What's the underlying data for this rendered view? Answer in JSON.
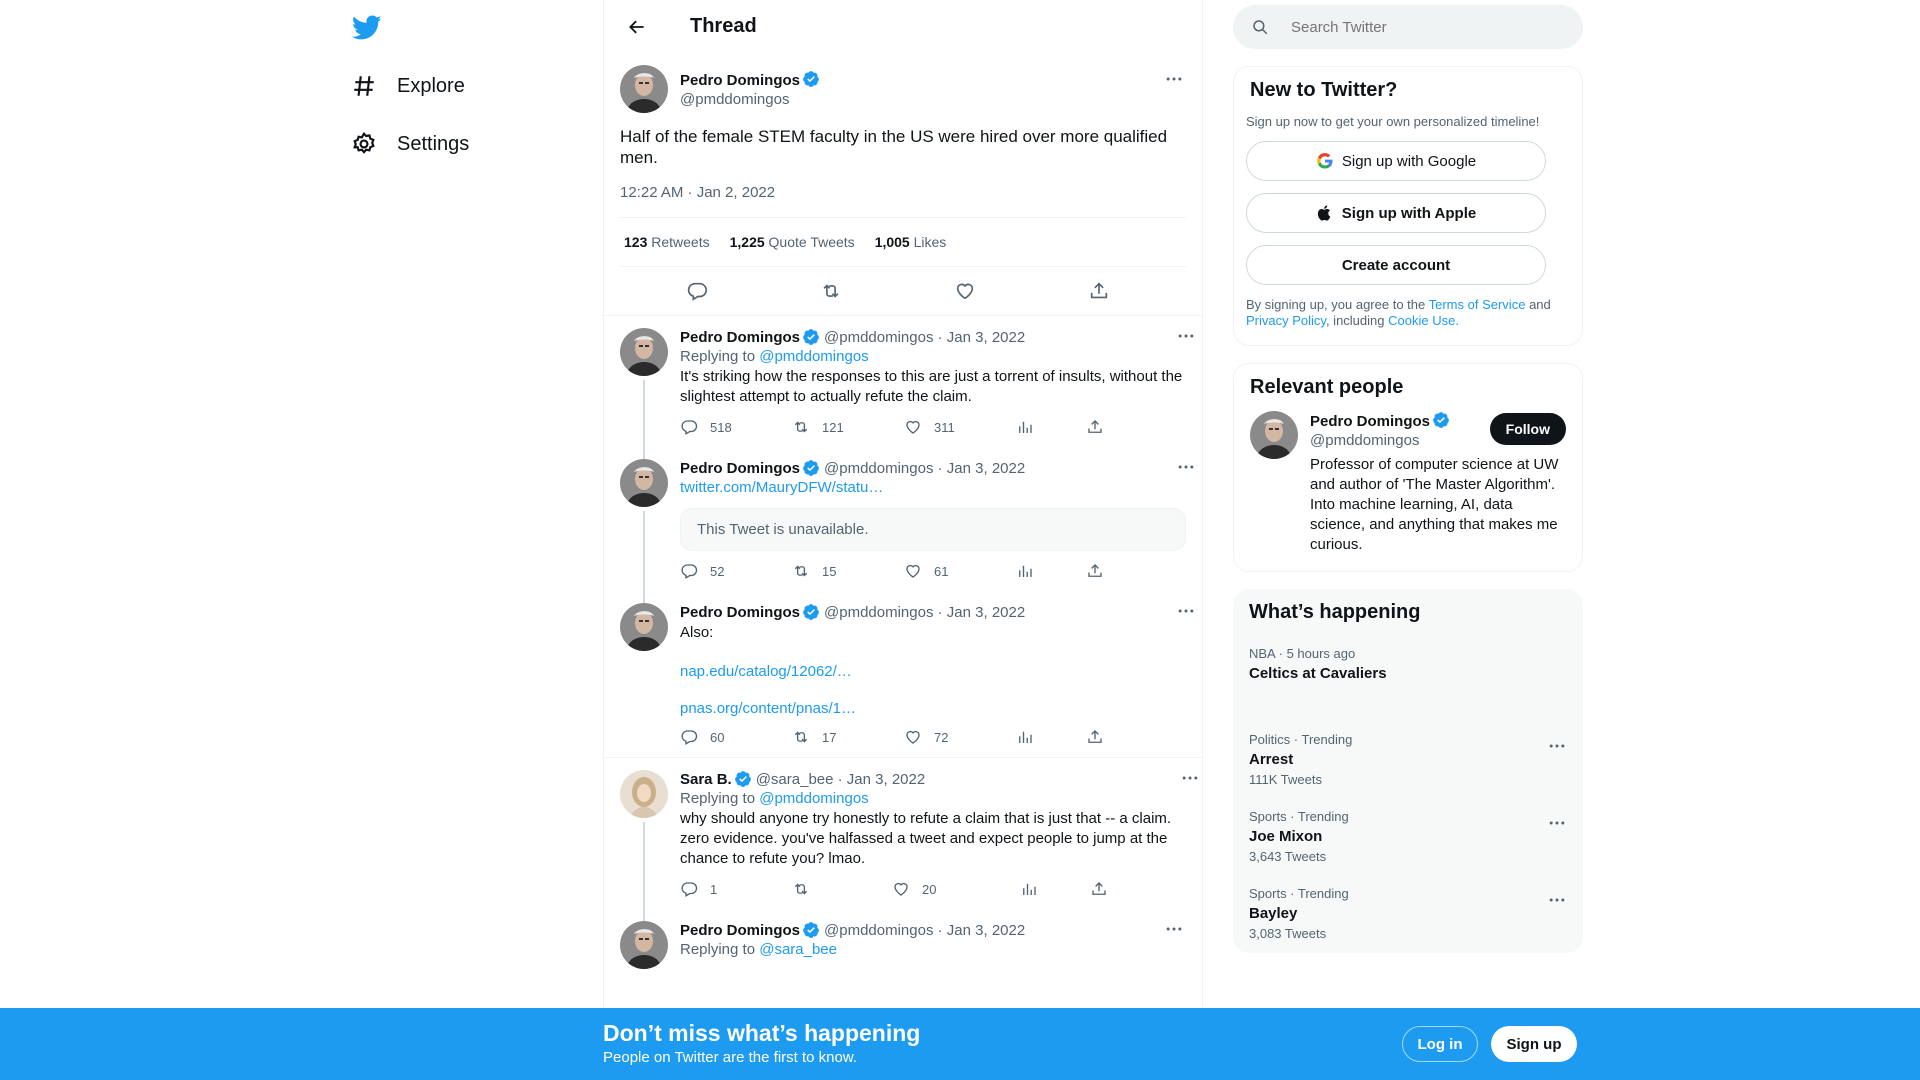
{
  "nav": {
    "explore": "Explore",
    "settings": "Settings"
  },
  "header": {
    "title": "Thread"
  },
  "main_tweet": {
    "name": "Pedro Domingos",
    "handle": "@pmddomingos",
    "text": "Half of the female STEM faculty in the US were hired over more qualified men.",
    "time": "12:22 AM · Jan 2, 2022",
    "retweets": "123",
    "retweets_label": "Retweets",
    "quotes": "1,225",
    "quotes_label": "Quote Tweets",
    "likes": "1,005",
    "likes_label": "Likes"
  },
  "replies": [
    {
      "name": "Pedro Domingos",
      "meta": "@pmddomingos · Jan 3, 2022",
      "replying_label": "Replying to",
      "replying_to": "@pmddomingos",
      "text": "It's striking how the responses to this are just a torrent of insults, without the slightest attempt to actually refute the claim.",
      "replies": "518",
      "retweets": "121",
      "likes": "311"
    },
    {
      "name": "Pedro Domingos",
      "meta": "@pmddomingos · Jan 3, 2022",
      "link": "twitter.com/MauryDFW/statu…",
      "unavailable": "This Tweet is unavailable.",
      "replies": "52",
      "retweets": "15",
      "likes": "61"
    },
    {
      "name": "Pedro Domingos",
      "meta": "@pmddomingos · Jan 3, 2022",
      "text": "Also:",
      "link1": "nap.edu/catalog/12062/…",
      "link2": "pnas.org/content/pnas/1…",
      "replies": "60",
      "retweets": "17",
      "likes": "72"
    },
    {
      "name": "Sara B.",
      "meta": "@sara_bee · Jan 3, 2022",
      "replying_label": "Replying to",
      "replying_to": "@pmddomingos",
      "text": "why should anyone try honestly to refute a claim that is just that -- a claim. zero evidence. you've halfassed a tweet and expect people to jump at the chance to refute you? lmao.",
      "replies": "1",
      "retweets": "",
      "likes": "20"
    },
    {
      "name": "Pedro Domingos",
      "meta": "@pmddomingos · Jan 3, 2022",
      "replying_label": "Replying to",
      "replying_to": "@sara_bee"
    }
  ],
  "search": {
    "placeholder": "Search Twitter"
  },
  "new_to_twitter": {
    "title": "New to Twitter?",
    "subtitle": "Sign up now to get your own personalized timeline!",
    "google": "Sign up with Google",
    "apple": "Sign up with Apple",
    "create": "Create account",
    "terms_prefix": "By signing up, you agree to the",
    "terms_link": "Terms of Service",
    "and": "and",
    "privacy_link": "Privacy Policy",
    "including": ", including",
    "cookie_link": "Cookie Use."
  },
  "relevant": {
    "title": "Relevant people",
    "name": "Pedro Domingos",
    "handle": "@pmddomingos",
    "follow": "Follow",
    "bio": "Professor of computer science at UW and author of 'The Master Algorithm'. Into machine learning, AI, data science, and anything that makes me curious."
  },
  "happening": {
    "title": "What’s happening",
    "trends": [
      {
        "cat": "NBA · 5 hours ago",
        "title": "Celtics at Cavaliers",
        "count": ""
      },
      {
        "cat": "Politics · Trending",
        "title": "Arrest",
        "count": "111K Tweets"
      },
      {
        "cat": "Sports · Trending",
        "title": "Joe Mixon",
        "count": "3,643 Tweets"
      },
      {
        "cat": "Sports · Trending",
        "title": "Bayley",
        "count": "3,083 Tweets"
      }
    ]
  },
  "banner": {
    "title": "Don’t miss what’s happening",
    "subtitle": "People on Twitter are the first to know.",
    "login": "Log in",
    "signup": "Sign up"
  },
  "colors": {
    "accent": "#1d9bf0",
    "text": "#0f1419",
    "muted": "#536471"
  }
}
